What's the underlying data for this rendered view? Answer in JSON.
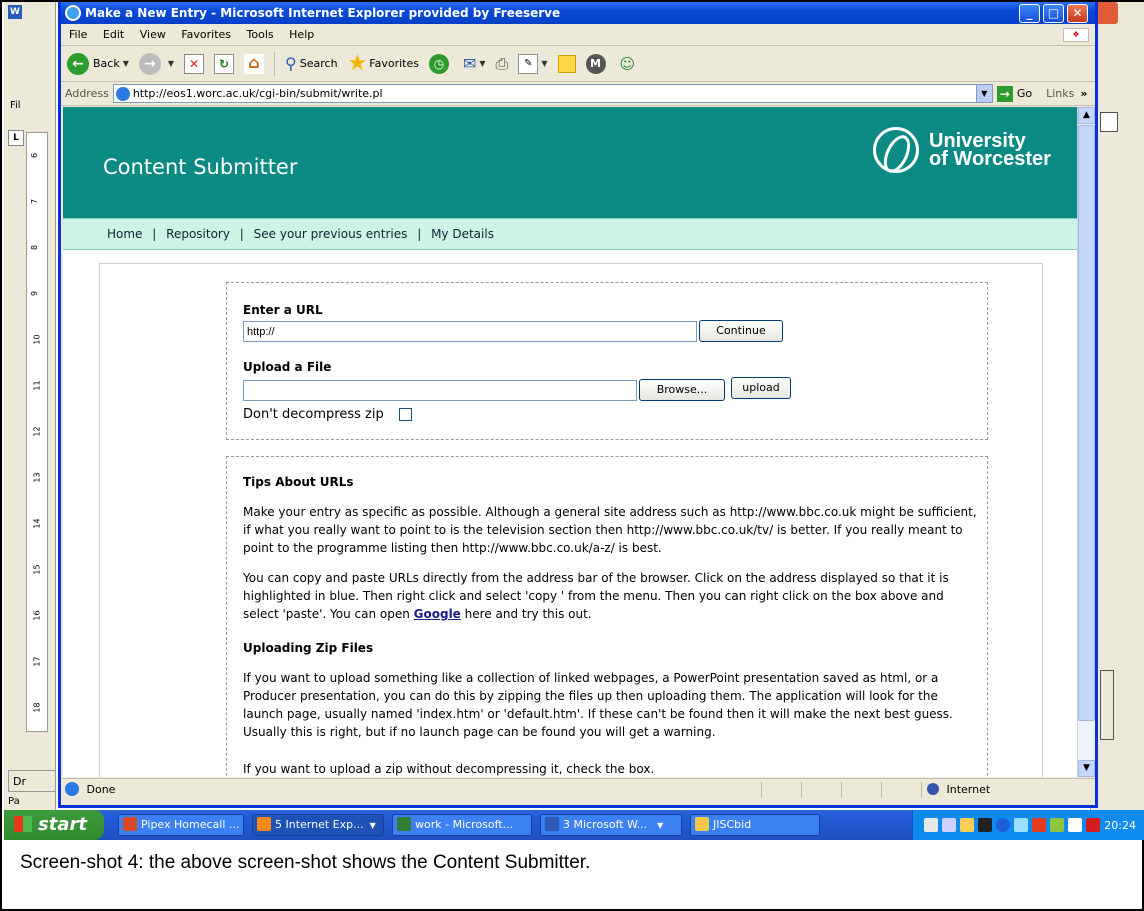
{
  "word": {
    "icon": "W",
    "left_menu": "Fil",
    "ruler_button": "L",
    "ruler_numbers": [
      "6",
      "7",
      "8",
      "9",
      "10",
      "11",
      "12",
      "13",
      "14",
      "15",
      "16",
      "17",
      "18"
    ],
    "draw_label": "Dr",
    "page_label": "Pa"
  },
  "ie": {
    "title": "Make a New Entry - Microsoft Internet Explorer provided by Freeserve",
    "menu": [
      "File",
      "Edit",
      "View",
      "Favorites",
      "Tools",
      "Help"
    ],
    "toolbar": {
      "back": "Back",
      "search": "Search",
      "favorites": "Favorites"
    },
    "address_label": "Address",
    "address_url": "http://eos1.worc.ac.uk/cgi-bin/submit/write.pl",
    "go": "Go",
    "links": "Links",
    "status_text": "Done",
    "zone_text": "Internet"
  },
  "site": {
    "title": "Content Submitter",
    "logo_line1": "University",
    "logo_line2": "of Worcester",
    "nav": [
      "Home",
      "Repository",
      "See your previous entries",
      "My Details"
    ],
    "nav_sep": "|"
  },
  "form": {
    "url_label": "Enter a URL",
    "url_value": "http://",
    "continue_label": "Continue",
    "file_label": "Upload a File",
    "file_value": "",
    "browse_label": "Browse...",
    "upload_label": "upload",
    "nozip_label": "Don't decompress zip",
    "nozip_checked": false
  },
  "tips": {
    "heading1": "Tips About URLs",
    "para1": "Make your entry as specific as possible. Although a general site address such as http://www.bbc.co.uk might be sufficient, if what you really want to point to is the television section then http://www.bbc.co.uk/tv/ is better. If you really meant to point to the programme listing then http://www.bbc.co.uk/a-z/ is best.",
    "para2_before": "You can copy and paste URLs directly from the address bar of the browser. Click on the address displayed so that it is highlighted in blue. Then right click and select 'copy ' from the menu. Then you can right click on the box above and select 'paste'. You can open ",
    "para2_link": "Google",
    "para2_after": " here and try this out.",
    "heading2": "Uploading Zip Files",
    "para3": "If you want to upload something like a collection of linked webpages, a PowerPoint presentation saved as html, or a Producer presentation, you can do this by zipping the files up then uploading them. The application will look for the launch page, usually named 'index.htm' or 'default.htm'. If these can't be found then it will make the next best guess. Usually this is right, but if no launch page can be found you will get a warning.",
    "para4": "If you want to upload a zip without decompressing it, check the box."
  },
  "taskbar": {
    "start": "start",
    "tasks": [
      {
        "label": "Pipex Homecall ...",
        "color": "#d94a2a"
      },
      {
        "label": "5 Internet Exp...",
        "color": "#f08a1a"
      },
      {
        "label": "work - Microsoft...",
        "color": "#2f7d2f"
      },
      {
        "label": "3 Microsoft W...",
        "color": "#2b5bb8"
      },
      {
        "label": "JISCbid",
        "color": "#f2c84a"
      }
    ],
    "clock": "20:24"
  },
  "caption": "Screen-shot 4: the above screen-shot shows the Content Submitter."
}
